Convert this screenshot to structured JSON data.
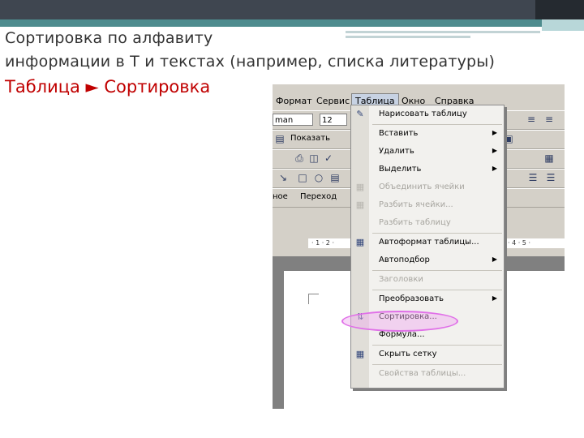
{
  "slide": {
    "title_line1": "Сортировка по алфавиту",
    "title_line2": "информации в Т и текстах (например, списка литературы)",
    "path_text": "Таблица ► Сортировка"
  },
  "menubar": {
    "items": [
      "Формат",
      "Сервис",
      "Таблица",
      "Окно",
      "Справка"
    ],
    "active": "Таблица"
  },
  "toolbar": {
    "font_name": "man",
    "font_size": "12",
    "show_label": "Показать",
    "go_label": "Переход",
    "review_label": "ное"
  },
  "table_menu": {
    "items": [
      {
        "label": "Нарисовать таблицу",
        "icon": "pencil-icon",
        "disabled": false,
        "submenu": false
      },
      {
        "label": "Вставить",
        "icon": "",
        "disabled": false,
        "submenu": true
      },
      {
        "label": "Удалить",
        "icon": "",
        "disabled": false,
        "submenu": true
      },
      {
        "label": "Выделить",
        "icon": "",
        "disabled": false,
        "submenu": true
      },
      {
        "label": "Объединить ячейки",
        "icon": "merge-cells-icon",
        "disabled": true,
        "submenu": false
      },
      {
        "label": "Разбить ячейки...",
        "icon": "split-cells-icon",
        "disabled": true,
        "submenu": false
      },
      {
        "label": "Разбить таблицу",
        "icon": "",
        "disabled": true,
        "submenu": false
      },
      {
        "label": "Автоформат таблицы...",
        "icon": "autoformat-icon",
        "disabled": false,
        "submenu": false
      },
      {
        "label": "Автоподбор",
        "icon": "",
        "disabled": false,
        "submenu": true
      },
      {
        "label": "Заголовки",
        "icon": "",
        "disabled": true,
        "submenu": false
      },
      {
        "label": "Преобразовать",
        "icon": "",
        "disabled": false,
        "submenu": true
      },
      {
        "label": "Сортировка...",
        "icon": "sort-icon",
        "disabled": false,
        "submenu": false
      },
      {
        "label": "Формула...",
        "icon": "",
        "disabled": false,
        "submenu": false
      },
      {
        "label": "Скрыть сетку",
        "icon": "grid-icon",
        "disabled": false,
        "submenu": false
      },
      {
        "label": "Свойства таблицы...",
        "icon": "",
        "disabled": true,
        "submenu": false
      }
    ]
  },
  "ruler": {
    "marks": "· 1 · 2 ·",
    "right_marks": "· 4 · 5 ·"
  }
}
